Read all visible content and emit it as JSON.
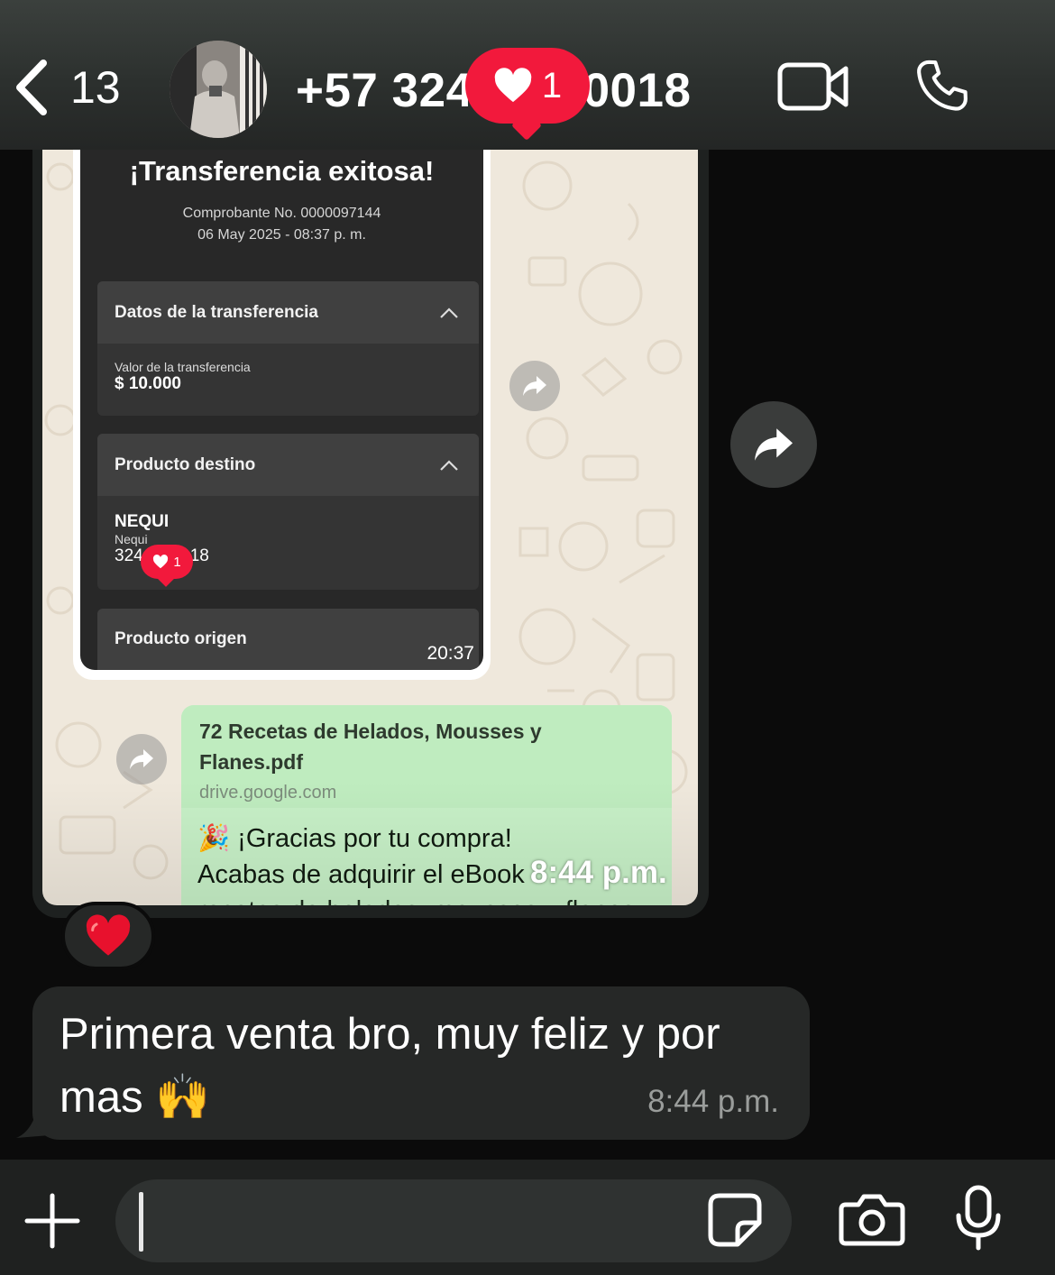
{
  "header": {
    "back_count": "13",
    "contact_title": "+57 324",
    "contact_title_tail": "0018",
    "notification_count": "1"
  },
  "receipt": {
    "title": "¡Transferencia exitosa!",
    "voucher": "Comprobante No. 0000097144",
    "date": "06 May 2025 - 08:37 p. m.",
    "section1_title": "Datos de la transferencia",
    "amount_label": "Valor de la transferencia",
    "amount_value": "$ 10.000",
    "section2_title": "Producto destino",
    "dest_name": "NEQUI",
    "dest_type": "Nequi",
    "dest_number_start": "324",
    "dest_number_end": "18",
    "mini_badge_count": "1",
    "section3_title": "Producto origen",
    "time": "20:37"
  },
  "link_message": {
    "title_line1": "72 Recetas de Helados, Mousses y",
    "title_line2": "Flanes.pdf",
    "domain": "drive.google.com",
    "text_line1": "🎉 ¡Gracias por tu compra!",
    "text_line2": "Acabas de adquirir el eBook",
    "text_line3": "recetas de helados, mousses y flanes",
    "overlay_time": "8:44 p.m."
  },
  "reaction": {
    "emoji": "❤️"
  },
  "text_message": {
    "body": "Primera venta bro, muy feliz y por mas 🙌",
    "time": "8:44 p.m."
  },
  "colors": {
    "badge_red": "#f2193c",
    "bubble_dark": "#262827",
    "link_green": "#c7f0c7"
  },
  "icons": [
    "chevron-left-icon",
    "video-icon",
    "phone-icon",
    "heart-icon",
    "forward-icon",
    "plus-icon",
    "sticker-icon",
    "camera-icon",
    "mic-icon",
    "chevron-up-icon"
  ]
}
